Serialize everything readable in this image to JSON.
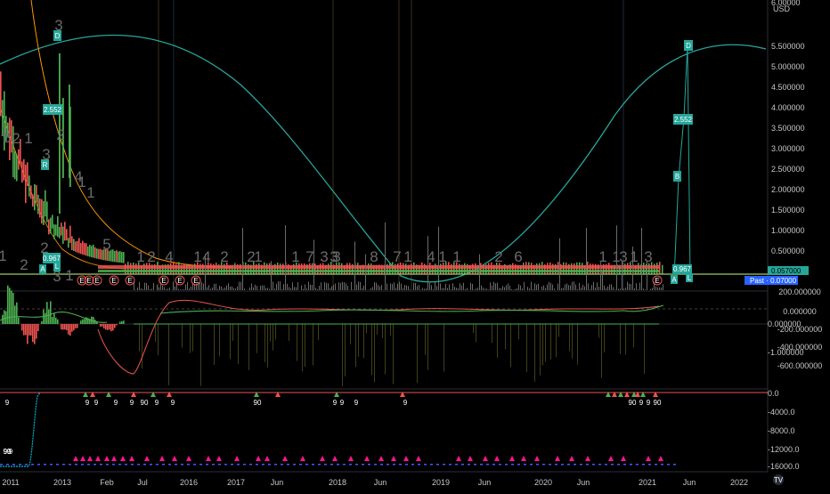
{
  "colors": {
    "background": "#000000",
    "curve": "#26a69a",
    "price_green": "#4caf50",
    "price_red": "#ef5350",
    "ma_orange": "#ff9800",
    "tag_teal": "#26a69a",
    "last_price_blue": "#2962ff",
    "axis_text": "#c7c7c7",
    "pink_marker": "#ff1493",
    "cyan_marker": "#00bcd4"
  },
  "price_axis": {
    "currency": "USD",
    "top_label": "6.00000",
    "labels": [
      "5.500000",
      "5.000000",
      "4.500000",
      "4.000000",
      "3.500000",
      "3.000000",
      "2.500000",
      "2.000000",
      "1.500000",
      "1.000000",
      "0.500000"
    ],
    "price_tag": "0.057000",
    "last_tag": "Past · 0.07000"
  },
  "osc_axis": {
    "right_labels": [
      "200.000000",
      "0.000000",
      "-200.000000",
      "-400.000000",
      "-600.000000"
    ],
    "left_labels": [
      "0.000000",
      "-1.000000"
    ]
  },
  "signal_axis": {
    "labels": [
      "0.0",
      "-4000.0",
      "-8000.0",
      "-12000.0",
      "-16000.0"
    ]
  },
  "time_axis": {
    "labels": [
      "2011",
      "2013",
      "Feb",
      "Jul",
      "2016",
      "2017",
      "Jun",
      "2018",
      "Jun",
      "2019",
      "Jun",
      "2020",
      "Jun",
      "2021",
      "Jun",
      "2022"
    ]
  },
  "annotations": {
    "big_numbers": [
      "3",
      "1",
      "2",
      "1",
      "3",
      "2",
      "1",
      "2",
      "2",
      "1",
      "1",
      "4",
      "1",
      "5",
      "3",
      "1",
      "2",
      "4",
      "1",
      "4",
      "2",
      "2",
      "1",
      "1",
      "7",
      "3",
      "3",
      "8",
      "7",
      "1",
      "4",
      "1",
      "1",
      "2",
      "6",
      "1",
      "1",
      "3",
      "1",
      "3",
      "3",
      "3"
    ],
    "tags_left": [
      "D",
      "2.552",
      "R",
      "0.967",
      "A",
      "L"
    ],
    "tags_right": [
      "D",
      "2.552",
      "B",
      "0.967",
      "A",
      "L"
    ],
    "e_markers": [
      "E",
      "E",
      "E",
      "E",
      "E",
      "E",
      "E",
      "E",
      "E"
    ],
    "small_glyphs": [
      "9",
      "9",
      "9",
      "9",
      "9",
      "90",
      "9",
      "9",
      "90",
      "9",
      "9",
      "9",
      "9",
      "90",
      "9",
      "9",
      "90",
      "9",
      "90",
      "9",
      "9"
    ]
  },
  "logo": "TV"
}
